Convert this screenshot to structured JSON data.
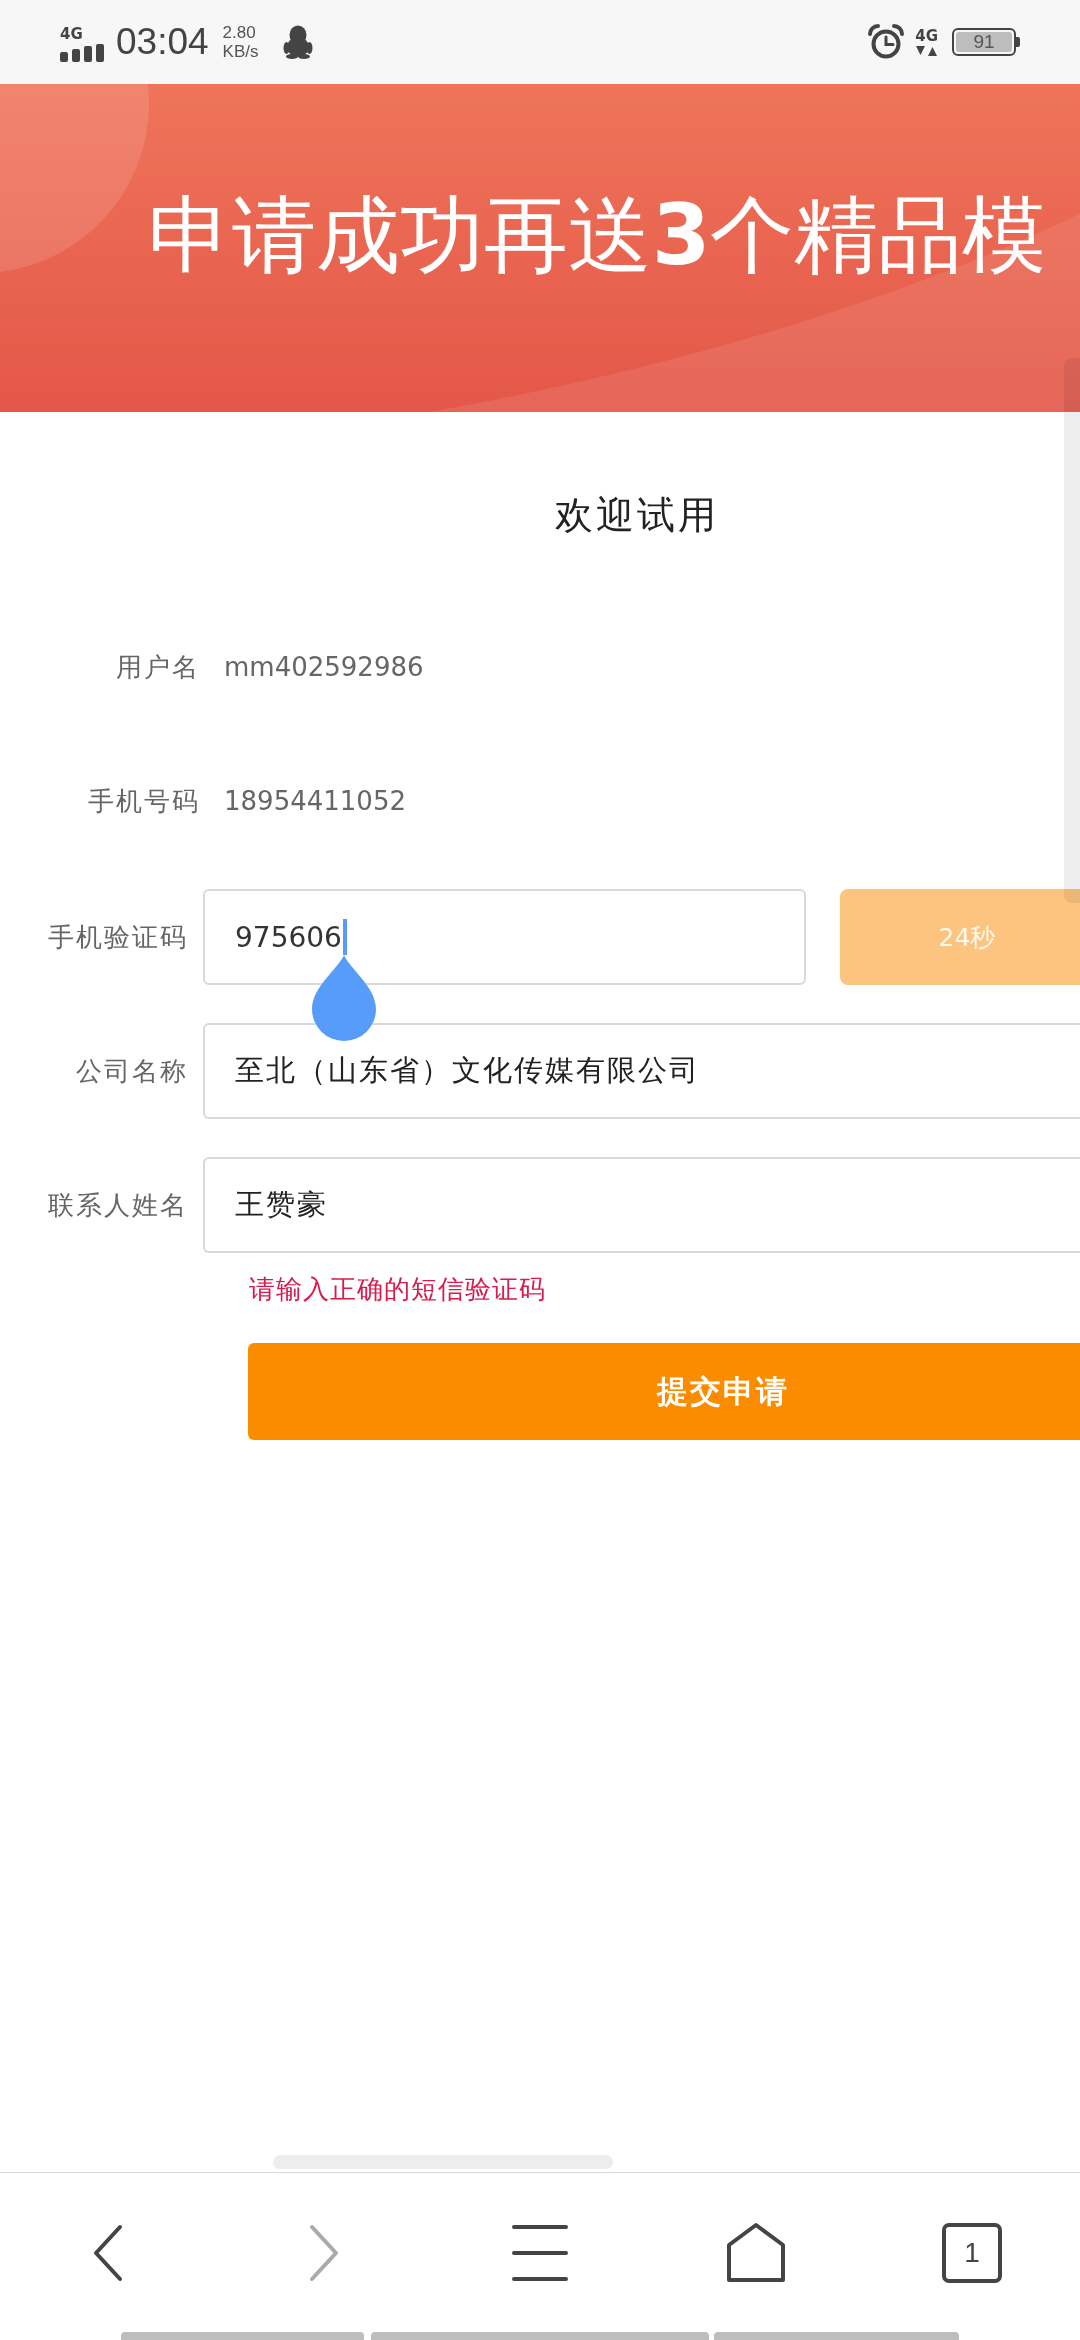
{
  "status_bar": {
    "signal_label": "4G",
    "time": "03:04",
    "speed_value": "2.80",
    "speed_unit": "KB/s",
    "data_label": "4G",
    "battery": "91"
  },
  "banner": {
    "text": "申请成功再送**3**个精品模"
  },
  "form": {
    "title": "欢迎试用",
    "info_rows": [
      {
        "label": "用户名",
        "value": "mm402592986"
      },
      {
        "label": "手机号码",
        "value": "18954411052"
      }
    ],
    "fields": [
      {
        "kind": "code",
        "label": "手机验证码",
        "value": "975606",
        "focused": true,
        "button": {
          "label": "24秒",
          "disabled": true
        }
      },
      {
        "kind": "text",
        "label": "公司名称",
        "value": "至北（山东省）文化传媒有限公司",
        "focused": false
      },
      {
        "kind": "text",
        "label": "联系人姓名",
        "value": "王赞豪",
        "focused": false
      }
    ],
    "error": "请输入正确的短信验证码",
    "submit": "提交申请"
  },
  "browser_nav": [
    {
      "kind": "back",
      "disabled": false
    },
    {
      "kind": "forward",
      "disabled": true
    },
    {
      "kind": "menu"
    },
    {
      "kind": "home"
    },
    {
      "kind": "tabs",
      "label": "1"
    }
  ]
}
